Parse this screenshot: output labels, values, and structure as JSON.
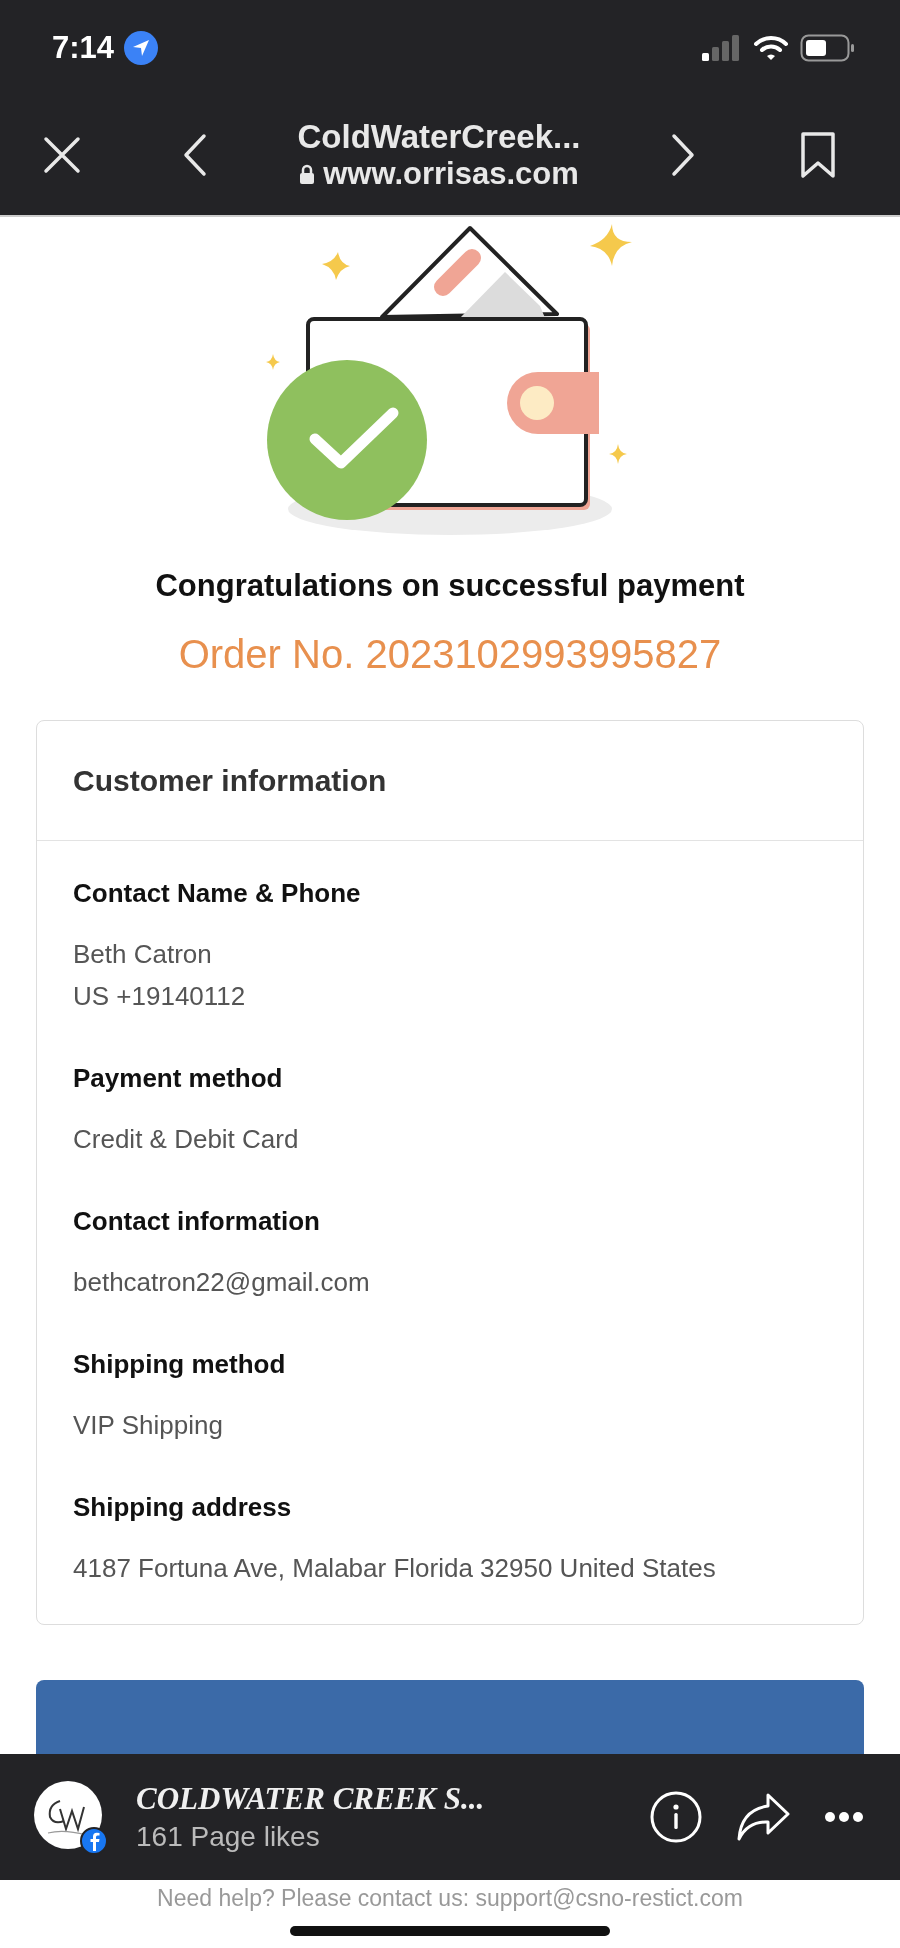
{
  "status_bar": {
    "time": "7:14"
  },
  "browser": {
    "title": "ColdWaterCreek...",
    "url": "www.orrisas.com"
  },
  "confirmation": {
    "title": "Congratulations on successful payment",
    "order_number": "Order No. 2023102993995827"
  },
  "customer_info": {
    "heading": "Customer information",
    "sections": [
      {
        "label": "Contact Name & Phone",
        "lines": [
          "Beth Catron",
          "US +19140112"
        ]
      },
      {
        "label": "Payment method",
        "lines": [
          "Credit & Debit Card"
        ]
      },
      {
        "label": "Contact information",
        "lines": [
          "bethcatron22@gmail.com"
        ]
      },
      {
        "label": "Shipping method",
        "lines": [
          "VIP Shipping"
        ]
      },
      {
        "label": "Shipping address",
        "lines": [
          "4187 Fortuna Ave, Malabar Florida 32950 United States"
        ]
      }
    ]
  },
  "facebook_bar": {
    "page_name": "COLDWATER CREEK S...",
    "likes": "161 Page likes"
  },
  "footer": {
    "help_text": "Need help? Please contact us: support@csno-restict.com"
  }
}
